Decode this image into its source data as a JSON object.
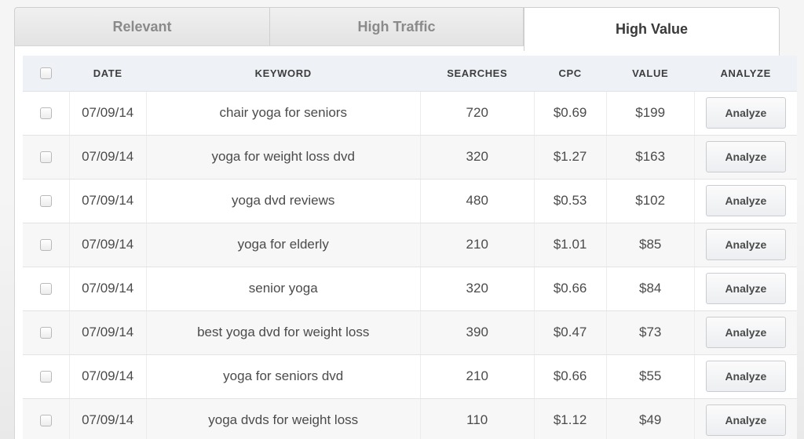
{
  "tabs": [
    {
      "label": "Relevant"
    },
    {
      "label": "High Traffic"
    },
    {
      "label": "High Value",
      "active": true
    }
  ],
  "table": {
    "headers": {
      "date": "DATE",
      "keyword": "KEYWORD",
      "searches": "SEARCHES",
      "cpc": "CPC",
      "value": "VALUE",
      "analyze": "ANALYZE"
    },
    "rows": [
      {
        "date": "07/09/14",
        "keyword": "chair yoga for seniors",
        "searches": "720",
        "cpc": "$0.69",
        "value": "$199",
        "action": "Analyze"
      },
      {
        "date": "07/09/14",
        "keyword": "yoga for weight loss dvd",
        "searches": "320",
        "cpc": "$1.27",
        "value": "$163",
        "action": "Analyze"
      },
      {
        "date": "07/09/14",
        "keyword": "yoga dvd reviews",
        "searches": "480",
        "cpc": "$0.53",
        "value": "$102",
        "action": "Analyze"
      },
      {
        "date": "07/09/14",
        "keyword": "yoga for elderly",
        "searches": "210",
        "cpc": "$1.01",
        "value": "$85",
        "action": "Analyze"
      },
      {
        "date": "07/09/14",
        "keyword": "senior yoga",
        "searches": "320",
        "cpc": "$0.66",
        "value": "$84",
        "action": "Analyze"
      },
      {
        "date": "07/09/14",
        "keyword": "best yoga dvd for weight loss",
        "searches": "390",
        "cpc": "$0.47",
        "value": "$73",
        "action": "Analyze"
      },
      {
        "date": "07/09/14",
        "keyword": "yoga for seniors dvd",
        "searches": "210",
        "cpc": "$0.66",
        "value": "$55",
        "action": "Analyze"
      },
      {
        "date": "07/09/14",
        "keyword": "yoga dvds for weight loss",
        "searches": "110",
        "cpc": "$1.12",
        "value": "$49",
        "action": "Analyze"
      }
    ]
  },
  "colors": {
    "header_bg": "#eef2f7",
    "active_tab_bg": "#ffffff",
    "inactive_tab_bg": "#e8e8e8"
  }
}
